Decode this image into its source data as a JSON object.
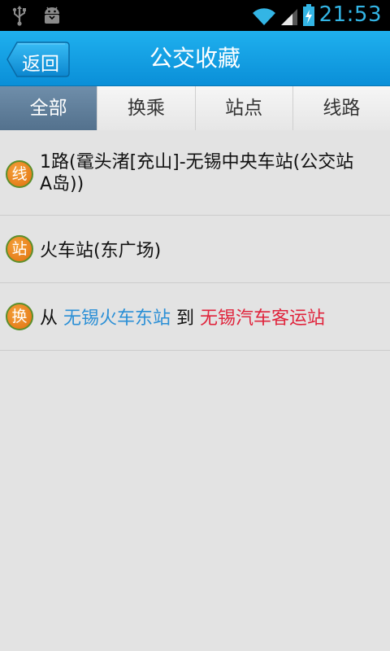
{
  "status_bar": {
    "time": "21:53",
    "icons": [
      "usb-icon",
      "android-debug-icon",
      "wifi-icon",
      "signal-icon",
      "battery-charging-icon"
    ]
  },
  "header": {
    "back_label": "返回",
    "title": "公交收藏"
  },
  "tabs": [
    {
      "label": "全部",
      "active": true
    },
    {
      "label": "换乘",
      "active": false
    },
    {
      "label": "站点",
      "active": false
    },
    {
      "label": "线路",
      "active": false
    }
  ],
  "favorites": [
    {
      "badge": "线",
      "text": "1路(鼋头渚[充山]-无锡中央车站(公交站A岛))"
    },
    {
      "badge": "站",
      "text": "火车站(东广场)"
    },
    {
      "badge": "换",
      "from_word": "从",
      "from": "无锡火车东站",
      "to_word": "到",
      "to": "无锡汽车客运站"
    }
  ],
  "colors": {
    "accent": "#1fb0ee",
    "active_tab": "#5f7f9c",
    "badge": "#ee8a1e",
    "from_station": "#2a8fd6",
    "to_station": "#e0243c"
  }
}
